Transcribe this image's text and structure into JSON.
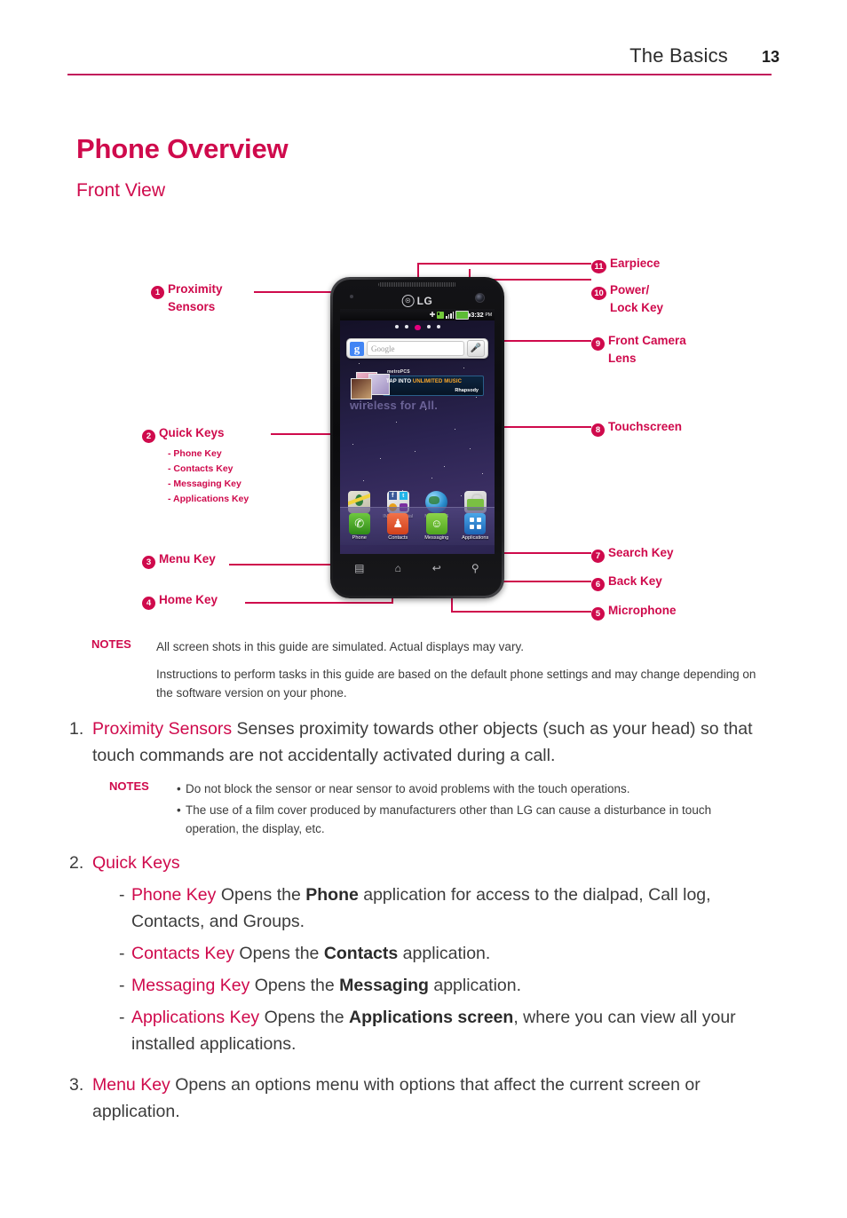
{
  "header": {
    "title": "The Basics",
    "page_number": "13",
    "rule_color": "#c2185b"
  },
  "titles": {
    "h1": "Phone Overview",
    "h2": "Front View",
    "accent_color": "#cf0a4c"
  },
  "diagram": {
    "left_callouts": [
      {
        "num": "1",
        "label": "Proximity",
        "label2": "Sensors"
      },
      {
        "num": "2",
        "label": "Quick Keys"
      },
      {
        "num": "3",
        "label": "Menu Key"
      },
      {
        "num": "4",
        "label": "Home Key"
      }
    ],
    "quick_key_sublist": [
      "- Phone Key",
      "- Contacts Key",
      "- Messaging Key",
      "- Applications Key"
    ],
    "right_callouts": [
      {
        "num": "11",
        "label": "Earpiece"
      },
      {
        "num": "10",
        "label": "Power/",
        "label2": "Lock Key"
      },
      {
        "num": "9",
        "label": "Front Camera",
        "label2": "Lens"
      },
      {
        "num": "8",
        "label": "Touchscreen"
      },
      {
        "num": "7",
        "label": "Search Key"
      },
      {
        "num": "6",
        "label": "Back Key"
      },
      {
        "num": "5",
        "label": "Microphone"
      }
    ],
    "phone": {
      "brand": "LG",
      "statusbar": {
        "time": "3:32",
        "ampm": "PM"
      },
      "search_widget": {
        "logo": "g",
        "placeholder": "Google",
        "mic_icon": "microphone-icon"
      },
      "promo": {
        "brand": "metroPCS",
        "headline_plain": "TAP INTO ",
        "headline_accent": "UNLIMITED MUSIC",
        "partner": "Rhapsody"
      },
      "wallpaper_text": "wireless for All.",
      "apps": [
        {
          "label": "Maps",
          "icon": "maps-icon"
        },
        {
          "label": "IM and Social",
          "icon": "im-social-icon"
        },
        {
          "label": "MetroWEB",
          "icon": "metroweb-icon"
        },
        {
          "label": "Market",
          "icon": "market-icon"
        }
      ],
      "dock": [
        {
          "label": "Phone",
          "icon": "phone-icon",
          "glyph": "✆"
        },
        {
          "label": "Contacts",
          "icon": "contacts-icon",
          "glyph": "♟"
        },
        {
          "label": "Messaging",
          "icon": "messaging-icon",
          "glyph": "☺"
        },
        {
          "label": "Applications",
          "icon": "applications-icon",
          "glyph": ""
        }
      ],
      "hardware_keys": [
        {
          "name": "menu-key",
          "glyph": "▤"
        },
        {
          "name": "home-key",
          "glyph": "⌂"
        },
        {
          "name": "back-key",
          "glyph": "↩"
        },
        {
          "name": "search-key",
          "glyph": "⚲"
        }
      ]
    }
  },
  "notes_top": {
    "tag": "NOTES",
    "line1": "All screen shots in this guide are simulated. Actual displays may vary.",
    "line2": "Instructions to perform tasks in this guide are based on the default phone settings and may change depending on the software version on your phone."
  },
  "body": {
    "item1": {
      "marker": "1.",
      "term": "Proximity Sensors",
      "text": " Senses proximity towards other objects (such as your head) so that touch commands are not accidentally activated during a call."
    },
    "notes_inner": {
      "tag": "NOTES",
      "bullets": [
        "Do not block the sensor or near sensor to avoid problems with the touch operations.",
        "The use of a film cover produced by manufacturers other than LG can cause a disturbance in touch operation, the display, etc."
      ]
    },
    "item2": {
      "marker": "2.",
      "term": "Quick Keys",
      "subitems": [
        {
          "dash": "-",
          "term": "Phone Key",
          "text_a": " Opens the ",
          "bold": "Phone",
          "text_b": " application for access to the dialpad, Call log, Contacts, and Groups."
        },
        {
          "dash": "-",
          "term": "Contacts Key",
          "text_a": " Opens the ",
          "bold": "Contacts",
          "text_b": " application."
        },
        {
          "dash": "-",
          "term": "Messaging Key",
          "text_a": " Opens the ",
          "bold": "Messaging",
          "text_b": " application."
        },
        {
          "dash": "-",
          "term": "Applications Key",
          "text_a": " Opens the ",
          "bold": "Applications screen",
          "text_b": ", where you can view all your installed applications."
        }
      ]
    },
    "item3": {
      "marker": "3.",
      "term": "Menu Key",
      "text": " Opens an options menu with options that affect the current screen or application."
    }
  }
}
